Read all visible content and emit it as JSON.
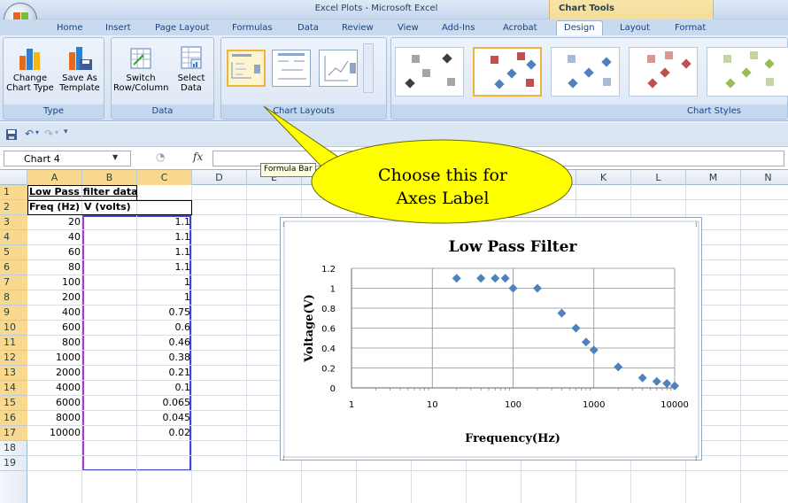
{
  "window": {
    "title": "Excel Plots - Microsoft Excel",
    "contextual_tab_header": "Chart Tools"
  },
  "tabs": [
    "Home",
    "Insert",
    "Page Layout",
    "Formulas",
    "Data",
    "Review",
    "View",
    "Add-Ins",
    "Acrobat",
    "Design",
    "Layout",
    "Format"
  ],
  "active_tab": "Design",
  "ribbon": {
    "type_group": {
      "label": "Type",
      "change_chart_type": "Change\nChart Type",
      "save_as_template": "Save As\nTemplate"
    },
    "data_group": {
      "label": "Data",
      "switch_row_column": "Switch\nRow/Column",
      "select_data": "Select\nData"
    },
    "chart_layouts_group": {
      "label": "Chart Layouts"
    },
    "chart_styles_group": {
      "label": "Chart Styles"
    },
    "colors": {
      "selected_highlight": "#f0b43a",
      "series_blue": "#4f81bd",
      "series_red": "#c0504d",
      "series_green": "#9bbb59",
      "gray": "#a5a5a5",
      "dark": "#3f3f3f"
    }
  },
  "formula_bar": {
    "name_box": "Chart 4",
    "fx_symbol": "fx",
    "formula": "",
    "tooltip": "Formula Bar"
  },
  "sheet": {
    "columns": [
      "A",
      "B",
      "C",
      "D",
      "E",
      "F",
      "G",
      "H",
      "I",
      "J",
      "K",
      "L",
      "M",
      "N"
    ],
    "selected_columns": [
      "A",
      "B",
      "C"
    ],
    "rows": [
      "1",
      "2",
      "3",
      "4",
      "5",
      "6",
      "7",
      "8",
      "9",
      "10",
      "11",
      "12",
      "13",
      "14",
      "15",
      "16",
      "17",
      "18",
      "19"
    ],
    "a1": "Low Pass filter data",
    "a2": "Freq (Hz)",
    "b2": "V (volts)",
    "freq": [
      "20",
      "40",
      "60",
      "80",
      "100",
      "200",
      "400",
      "600",
      "800",
      "1000",
      "2000",
      "4000",
      "6000",
      "8000",
      "10000"
    ],
    "volts": [
      "1.1",
      "1.1",
      "1.1",
      "1.1",
      "1",
      "1",
      "0.75",
      "0.6",
      "0.46",
      "0.38",
      "0.21",
      "0.1",
      "0.065",
      "0.045",
      "0.02"
    ]
  },
  "callout": {
    "line1": "Choose this for",
    "line2": "Axes Label",
    "fill": "#ffff00"
  },
  "chart_data": {
    "type": "scatter",
    "title": "Low Pass Filter",
    "xlabel": "Frequency(Hz)",
    "ylabel": "Voltage(V)",
    "x_scale": "log",
    "xlim": [
      1,
      10000
    ],
    "ylim": [
      0,
      1.2
    ],
    "x_ticks": [
      "1",
      "10",
      "100",
      "1000",
      "10000"
    ],
    "y_ticks": [
      "0",
      "0.2",
      "0.4",
      "0.6",
      "0.8",
      "1",
      "1.2"
    ],
    "grid": "major gridlines",
    "marker": "diamond",
    "marker_color": "#4f81bd",
    "series": [
      {
        "x": [
          20,
          40,
          60,
          80,
          100,
          200,
          400,
          600,
          800,
          1000,
          2000,
          4000,
          6000,
          8000,
          10000
        ],
        "y": [
          1.1,
          1.1,
          1.1,
          1.1,
          1,
          1,
          0.75,
          0.6,
          0.46,
          0.38,
          0.21,
          0.1,
          0.065,
          0.045,
          0.02
        ]
      }
    ]
  }
}
